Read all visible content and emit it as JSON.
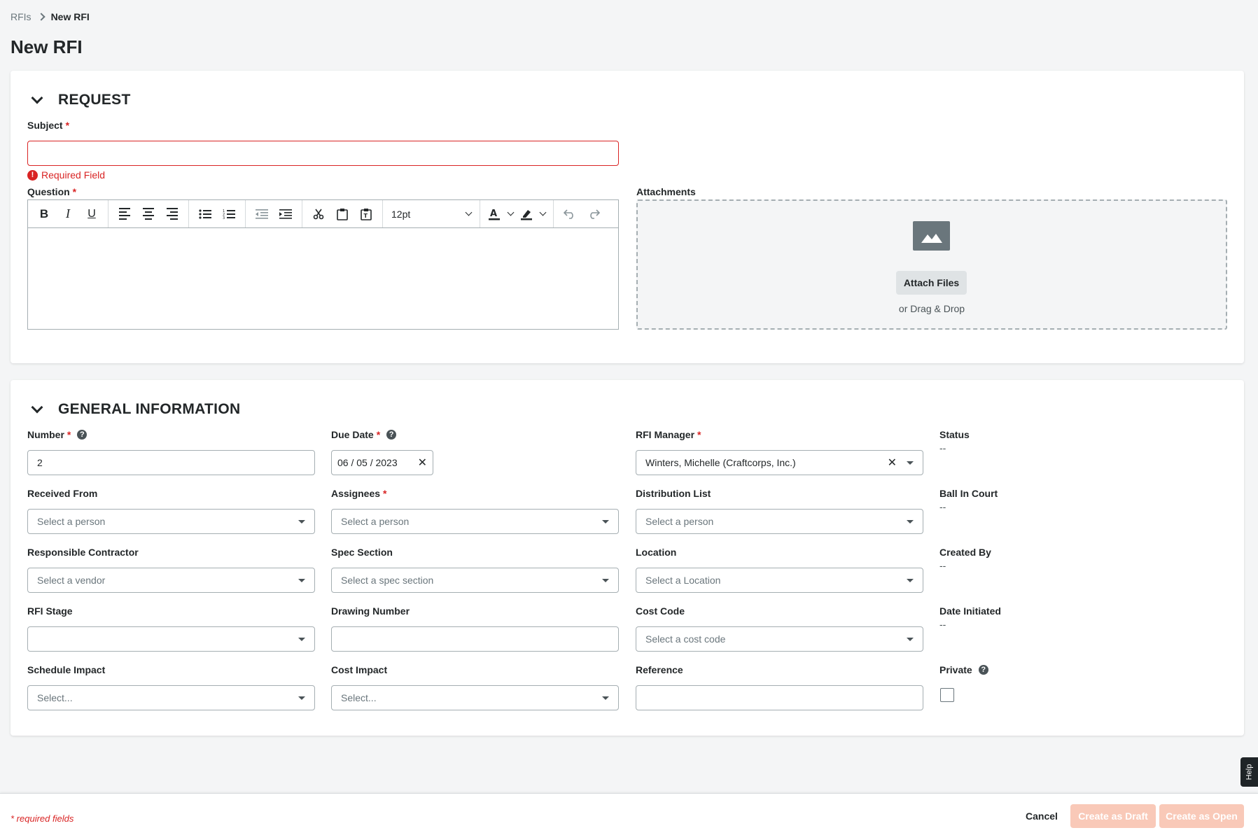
{
  "breadcrumb": {
    "parent": "RFIs",
    "current": "New RFI"
  },
  "page_title": "New RFI",
  "request": {
    "title": "REQUEST",
    "subject": {
      "label": "Subject",
      "required": "*",
      "value": "",
      "error": "Required Field"
    },
    "question": {
      "label": "Question",
      "required": "*",
      "font_size": "12pt"
    },
    "attachments": {
      "label": "Attachments",
      "button": "Attach Files",
      "hint": "or Drag & Drop"
    }
  },
  "general": {
    "title": "GENERAL INFORMATION",
    "number": {
      "label": "Number",
      "required": "*",
      "value": "2"
    },
    "due_date": {
      "label": "Due Date",
      "required": "*",
      "value": "06 / 05 / 2023"
    },
    "rfi_manager": {
      "label": "RFI Manager",
      "required": "*",
      "value": "Winters, Michelle (Craftcorps, Inc.)"
    },
    "status": {
      "label": "Status",
      "value": "--"
    },
    "received_from": {
      "label": "Received From",
      "placeholder": "Select a person"
    },
    "assignees": {
      "label": "Assignees",
      "required": "*",
      "placeholder": "Select a person"
    },
    "distribution_list": {
      "label": "Distribution List",
      "placeholder": "Select a person"
    },
    "ball_in_court": {
      "label": "Ball In Court",
      "value": "--"
    },
    "responsible_contractor": {
      "label": "Responsible Contractor",
      "placeholder": "Select a vendor"
    },
    "spec_section": {
      "label": "Spec Section",
      "placeholder": "Select a spec section"
    },
    "location": {
      "label": "Location",
      "placeholder": "Select a Location"
    },
    "created_by": {
      "label": "Created By",
      "value": "--"
    },
    "rfi_stage": {
      "label": "RFI Stage",
      "placeholder": ""
    },
    "drawing_number": {
      "label": "Drawing Number",
      "value": ""
    },
    "cost_code": {
      "label": "Cost Code",
      "placeholder": "Select a cost code"
    },
    "date_initiated": {
      "label": "Date Initiated",
      "value": "--"
    },
    "schedule_impact": {
      "label": "Schedule Impact",
      "placeholder": "Select..."
    },
    "cost_impact": {
      "label": "Cost Impact",
      "placeholder": "Select..."
    },
    "reference": {
      "label": "Reference",
      "value": ""
    },
    "private": {
      "label": "Private",
      "checked": false
    }
  },
  "footer": {
    "required_note": "* required fields",
    "cancel": "Cancel",
    "create_draft": "Create as Draft",
    "create_open": "Create as Open"
  },
  "help_tab": "Help",
  "colors": {
    "error": "#d92424",
    "disabled_button": "#f9c9b8",
    "page_bg": "#f4f5f6"
  }
}
